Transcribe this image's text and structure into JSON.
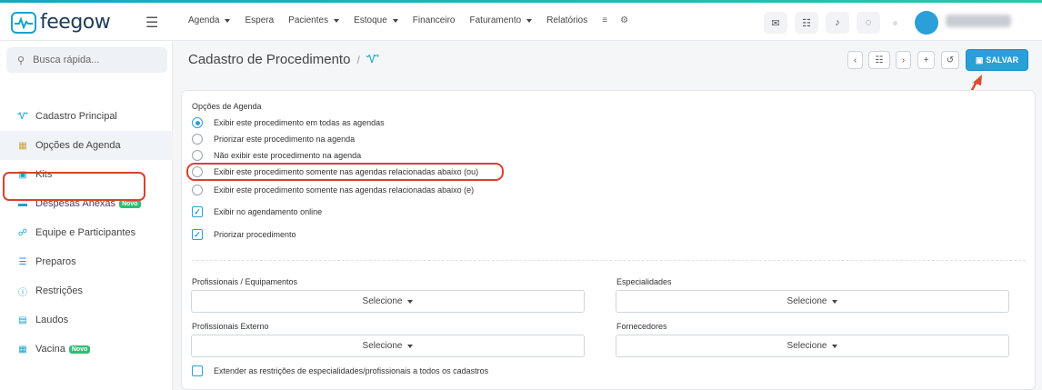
{
  "app": {
    "logo_text": "feegow"
  },
  "header": {
    "nav": [
      {
        "label": "Agenda",
        "dropdown": true
      },
      {
        "label": "Espera",
        "dropdown": false
      },
      {
        "label": "Pacientes",
        "dropdown": true
      },
      {
        "label": "Estoque",
        "dropdown": true
      },
      {
        "label": "Financeiro",
        "dropdown": false
      },
      {
        "label": "Faturamento",
        "dropdown": true
      },
      {
        "label": "Relatórios",
        "dropdown": false
      }
    ]
  },
  "search": {
    "placeholder": "Busca rápida..."
  },
  "sidebar": {
    "items": [
      {
        "label": "Cadastro Principal",
        "icon": "stethoscope-icon"
      },
      {
        "label": "Opções de Agenda",
        "icon": "calendar-icon",
        "active": true
      },
      {
        "label": "Kits",
        "icon": "kit-icon"
      },
      {
        "label": "Despesas Anexas",
        "icon": "card-icon",
        "badge": "Novo"
      },
      {
        "label": "Equipe e Participantes",
        "icon": "team-icon"
      },
      {
        "label": "Preparos",
        "icon": "list-icon"
      },
      {
        "label": "Restrições",
        "icon": "info-icon"
      },
      {
        "label": "Laudos",
        "icon": "document-icon"
      },
      {
        "label": "Vacina",
        "icon": "calendar-icon",
        "badge": "Novo"
      }
    ]
  },
  "page": {
    "title": "Cadastro de Procedimento",
    "breadcrumb_sep": "/",
    "save_label": "SALVAR"
  },
  "agenda": {
    "section_label": "Opções de Agenda",
    "radios": [
      {
        "label": "Exibir este procedimento em todas as agendas",
        "checked": true
      },
      {
        "label": "Priorizar este procedimento na agenda",
        "checked": false
      },
      {
        "label": "Não exibir este procedimento na agenda",
        "checked": false
      },
      {
        "label": "Exibir este procedimento somente nas agendas relacionadas abaixo (ou)",
        "checked": false
      },
      {
        "label": "Exibir este procedimento somente nas agendas relacionadas abaixo (e)",
        "checked": false
      }
    ],
    "checkboxes": [
      {
        "label": "Exibir no agendamento online",
        "checked": true
      },
      {
        "label": "Priorizar procedimento",
        "checked": true
      }
    ]
  },
  "fields": {
    "profissionais_label": "Profissionais / Equipamentos",
    "especialidades_label": "Especialidades",
    "externo_label": "Profissionais Externo",
    "fornecedores_label": "Fornecedores",
    "select_value": "Selecione",
    "extend_label": "Extender as restrições de especialidades/profissionais a todos os cadastros"
  },
  "colors": {
    "accent": "#2a9fd8",
    "highlight": "#d9432c",
    "badge": "#2fbf71"
  }
}
